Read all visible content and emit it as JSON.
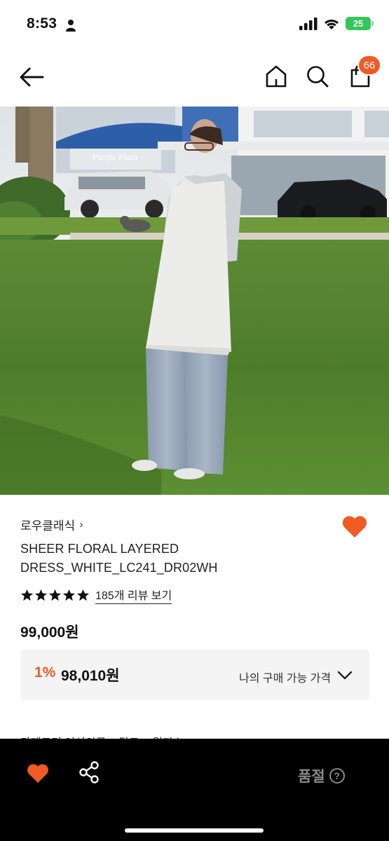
{
  "status_bar": {
    "time": "8:53",
    "battery": "25"
  },
  "nav": {
    "cart_count": "66"
  },
  "product": {
    "brand": "로우클래식",
    "brand_chevron": "›",
    "name": "SHEER FLORAL LAYERED DRESS_WHITE_LC241_DR02WH",
    "rating_stars": 5,
    "review_link": "185개 리뷰 보기",
    "price": "99,000원",
    "discount_rate": "1%",
    "discount_price": "98,010원",
    "benefit_label": "나의 구매 가능 가격",
    "category_peek": "카테고리 여성의류 > 탑드 > 원피스"
  },
  "hero": {
    "sign_text": "Pacific Plaza"
  },
  "bottom_bar": {
    "status_label": "품절",
    "help_glyph": "?"
  },
  "icons": {
    "back": "arrow-left-icon",
    "home": "home-icon",
    "search": "search-icon",
    "cart": "shopping-bag-icon",
    "wishlist": "heart-icon",
    "share": "share-icon",
    "help": "question-circle-icon"
  },
  "colors": {
    "accent": "#f05a23",
    "bottom_bar": "#000000",
    "benefit_bg": "#f4f4f4",
    "battery": "#34c759",
    "soldout_text": "#8a8a8a"
  }
}
